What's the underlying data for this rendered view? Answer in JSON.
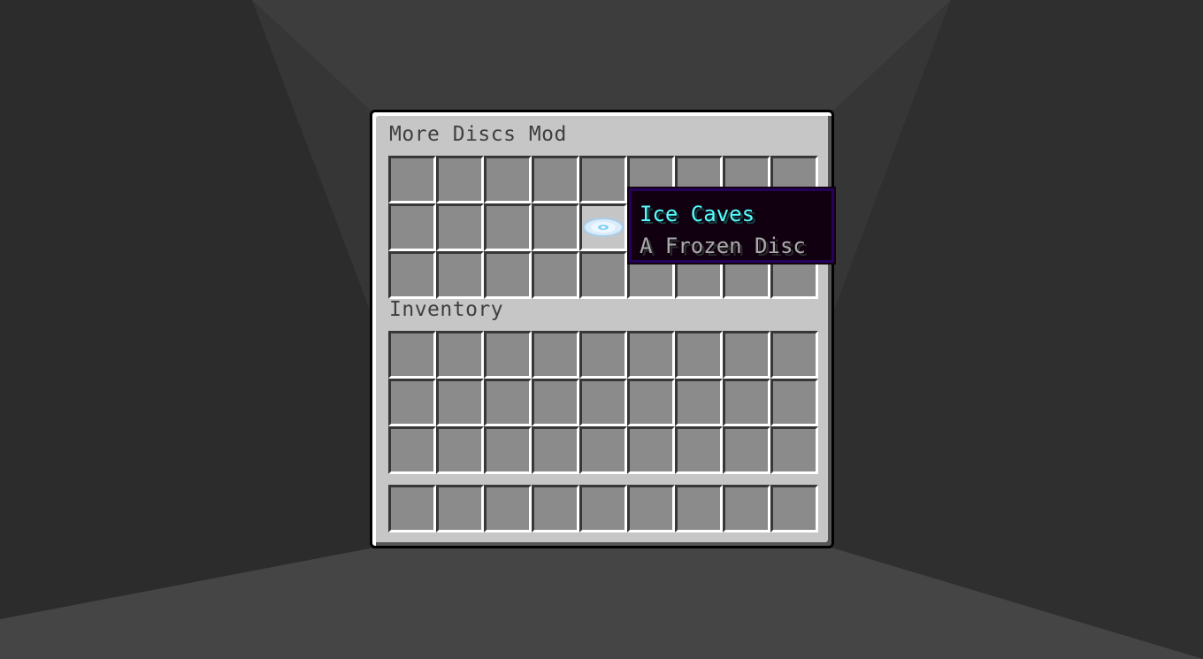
{
  "gui": {
    "title": "More Discs Mod",
    "inventory_label": "Inventory",
    "container_rows": [
      [
        "",
        "",
        "",
        "",
        "",
        "",
        "",
        "",
        ""
      ],
      [
        "",
        "",
        "",
        "",
        "music-disc-ice-caves",
        "",
        "",
        "",
        ""
      ],
      [
        "",
        "",
        "",
        "",
        "",
        "",
        "",
        "",
        ""
      ]
    ],
    "inventory_rows": 3,
    "hotbar_slots": 9
  },
  "tooltip": {
    "title": "Ice Caves",
    "subtitle": "A Frozen Disc",
    "title_color": "#55ffff",
    "subtitle_color": "#aaaaaa"
  },
  "colors": {
    "panel": "#c6c6c6",
    "slot": "#8b8b8b",
    "slot_hover": "#c5c5c5",
    "tooltip_bg": "#100010",
    "tooltip_border": "#25015b"
  }
}
